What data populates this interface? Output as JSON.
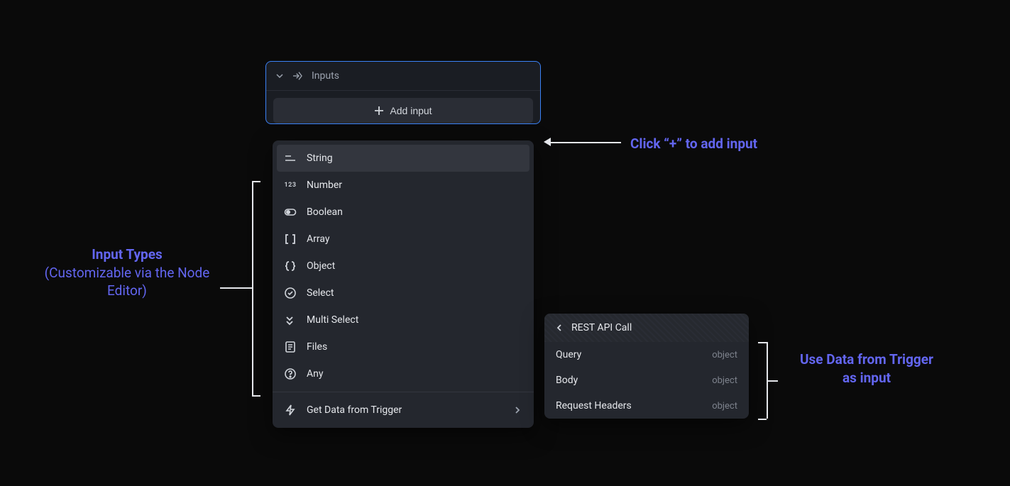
{
  "panel": {
    "title": "Inputs",
    "add_label": "Add input"
  },
  "types": [
    {
      "label": "String",
      "icon": "text-icon"
    },
    {
      "label": "Number",
      "icon": "number-icon"
    },
    {
      "label": "Boolean",
      "icon": "toggle-icon"
    },
    {
      "label": "Array",
      "icon": "brackets-icon"
    },
    {
      "label": "Object",
      "icon": "braces-icon"
    },
    {
      "label": "Select",
      "icon": "select-icon"
    },
    {
      "label": "Multi Select",
      "icon": "multi-select-icon"
    },
    {
      "label": "Files",
      "icon": "file-icon"
    },
    {
      "label": "Any",
      "icon": "question-icon"
    }
  ],
  "trigger_item": {
    "label": "Get Data from Trigger",
    "icon": "bolt-icon"
  },
  "flyout": {
    "title": "REST API Call",
    "rows": [
      {
        "label": "Query",
        "type": "object"
      },
      {
        "label": "Body",
        "type": "object"
      },
      {
        "label": "Request Headers",
        "type": "object"
      }
    ]
  },
  "annotations": {
    "left_title": "Input Types",
    "left_sub": "(Customizable via the Node Editor)",
    "top": "Click “+” to add input",
    "right_line1": "Use Data from Trigger",
    "right_line2": "as input"
  }
}
